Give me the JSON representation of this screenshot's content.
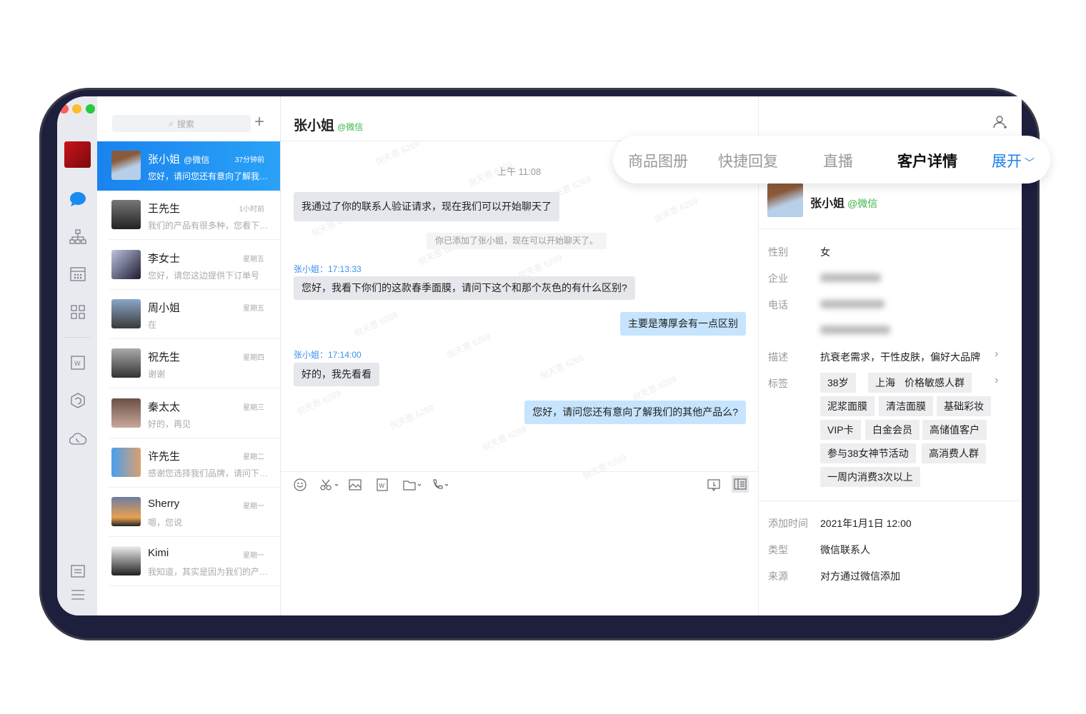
{
  "watermark": "倪天恩 6269",
  "search": {
    "placeholder": "搜索"
  },
  "colors": {
    "accent": "#1a83ee",
    "wechat_green": "#3bb44a",
    "bezel": "#1e1e3d"
  },
  "conversations": [
    {
      "name": "张小姐",
      "tag": "@微信",
      "time": "37分钟前",
      "preview": "您好，请问您还有意向了解我们的其他产品么？",
      "active": true
    },
    {
      "name": "王先生",
      "time": "1小时前",
      "preview": "我们的产品有很多种，您看下…"
    },
    {
      "name": "李女士",
      "time": "星期五",
      "preview": "您好，请您这边提供下订单号"
    },
    {
      "name": "周小姐",
      "time": "星期五",
      "preview": "在"
    },
    {
      "name": "祝先生",
      "time": "星期四",
      "preview": "谢谢"
    },
    {
      "name": "秦太太",
      "time": "星期三",
      "preview": "好的，再见"
    },
    {
      "name": "许先生",
      "time": "星期二",
      "preview": "感谢您选择我们品牌，请问下…"
    },
    {
      "name": "Sherry",
      "time": "星期一",
      "preview": "嗯，您说"
    },
    {
      "name": "Kimi",
      "time": "星期一",
      "preview": "我知道，其实是因为我们的产…"
    }
  ],
  "chat": {
    "title": "张小姐",
    "title_tag": "@微信",
    "time_divider": "上午 11:08",
    "msg1": "我通过了你的联系人验证请求，现在我们可以开始聊天了",
    "system": "你已添加了张小姐，现在可以开始聊天了。",
    "sender1": "张小姐：17:13:33",
    "msg2": "您好，我看下你们的这款春季面膜，请问下这个和那个灰色的有什么区别?",
    "msg3": "主要是薄厚会有一点区别",
    "sender2": "张小姐：17:14:00",
    "msg4": "好的，我先看看",
    "msg5": "您好，请问您还有意向了解我们的其他产品么?"
  },
  "tabs": [
    "商品图册",
    "快捷回复",
    "直播",
    "客户详情"
  ],
  "active_tab": "客户详情",
  "expand_label": "展开",
  "customer": {
    "name": "张小姐",
    "tag": "@微信",
    "gender_label": "性别",
    "gender": "女",
    "company_label": "企业",
    "phone_label": "电话",
    "desc_label": "描述",
    "desc": "抗衰老需求，干性皮肤，偏好大品牌",
    "tags_label": "标签",
    "tags": [
      "38岁",
      "上海",
      "价格敏感人群",
      "泥浆面膜",
      "清洁面膜",
      "基础彩妆",
      "VIP卡",
      "白金会员",
      "高储值客户",
      "参与38女神节活动",
      "高消费人群",
      "一周内消费3次以上"
    ],
    "added_label": "添加时间",
    "added": "2021年1月1日 12:00",
    "type_label": "类型",
    "type": "微信联系人",
    "source_label": "来源",
    "source": "对方通过微信添加"
  }
}
